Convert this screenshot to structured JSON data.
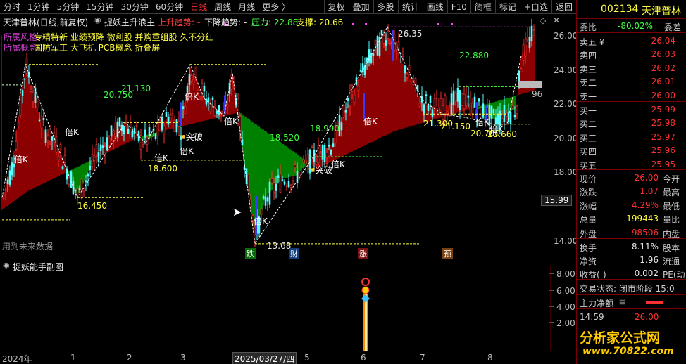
{
  "toolbar": {
    "periods": [
      "分时",
      "1分钟",
      "5分钟",
      "15分钟",
      "30分钟",
      "60分钟",
      "日线",
      "周线",
      "月线",
      "更多 〉"
    ],
    "active_index": 6,
    "buttons": [
      "复权",
      "叠加",
      "多股",
      "统计",
      "画线",
      "F10",
      "简框",
      "标记",
      "+自选",
      "返回"
    ]
  },
  "chart": {
    "stock_title": "天津普林(日线,前复权)",
    "indicator_name": "捉妖主升浪主",
    "up_trend_label": "上升趋势: -",
    "down_trend_label": "下降趋势: -",
    "pressure_label": "压力: 22.88",
    "support_label": "支撑: 20.66",
    "concept_row1_tag": "所属风格",
    "concept_row1": "专精特新 业绩预降 微利股 并购重组股 久不分红",
    "concept_row2_tag": "所属概念",
    "concept_row2": "国防军工 大飞机 PCB概念 折叠屏",
    "future_data_note": "用到未来数据",
    "price_ticks": [
      "26.00",
      "24.00",
      "22.00",
      "20.00",
      "18.00",
      "16.00",
      "14.00"
    ],
    "last_price_box": "15.99",
    "right_edge_label": "96",
    "levels": [
      "26.35",
      "22.880",
      "21.130",
      "20.750",
      "18.990",
      "18.520",
      "18.600",
      "16.450",
      "13.68",
      "21.300",
      "21.150",
      "20.700",
      "20.660"
    ],
    "beik": "倍K",
    "tupo": "突破",
    "bottom_tags": [
      "跌",
      "财",
      "涨",
      "预"
    ],
    "x_axis": [
      "2024年",
      "1",
      "2",
      "3",
      "2025/03/27/四",
      "5",
      "6",
      "7",
      "8"
    ],
    "sub_title": "捉妖能手副图",
    "sub_ticks": [
      "8.00",
      "6.00",
      "4.00",
      "2.00"
    ],
    "colors": {
      "up": "#ff3030",
      "down": "#54ffff",
      "bull_fill": "#8b0000",
      "bear_fill": "#008000",
      "level_text": "#ffff40",
      "green_text": "#40ff40"
    }
  },
  "panel": {
    "code": "002134",
    "name": "天津普林",
    "wei_bi_label": "委比",
    "wei_bi": "-80.02%",
    "wei_cha_label": "委差",
    "asks": [
      {
        "label": "卖五 ¥",
        "price": "26.04"
      },
      {
        "label": "卖四",
        "price": "26.03"
      },
      {
        "label": "卖三",
        "price": "26.02"
      },
      {
        "label": "卖二",
        "price": "26.01"
      },
      {
        "label": "卖一",
        "price": "26.00"
      }
    ],
    "bids": [
      {
        "label": "买一",
        "price": "25.99"
      },
      {
        "label": "买二",
        "price": "25.98"
      },
      {
        "label": "买三",
        "price": "25.97"
      },
      {
        "label": "买四",
        "price": "25.96"
      },
      {
        "label": "买五",
        "price": "25.95"
      }
    ],
    "quote": [
      {
        "label": "现价",
        "value": "26.00",
        "extra": "今开"
      },
      {
        "label": "涨跌",
        "value": "1.07",
        "extra": "最高"
      },
      {
        "label": "涨幅",
        "value": "4.29%",
        "extra": "最低"
      },
      {
        "label": "总量",
        "value": "199443",
        "extra": "量比"
      },
      {
        "label": "外盘",
        "value": "98506",
        "extra": "内盘"
      }
    ],
    "stats": [
      {
        "label": "换手",
        "value": "8.11%",
        "extra": "股本"
      },
      {
        "label": "净资",
        "value": "1.96",
        "extra": "流通"
      },
      {
        "label": "收益(-)",
        "value": "0.002",
        "extra": "PE(动"
      }
    ],
    "trade_status": "交易状态: 闭市阶段 15:0",
    "main_flow": "主力净额",
    "tick_time": "14:59",
    "tick_price": "26.00",
    "watermark_cn": "分析家公式网",
    "watermark_url": "www.70822.com"
  }
}
